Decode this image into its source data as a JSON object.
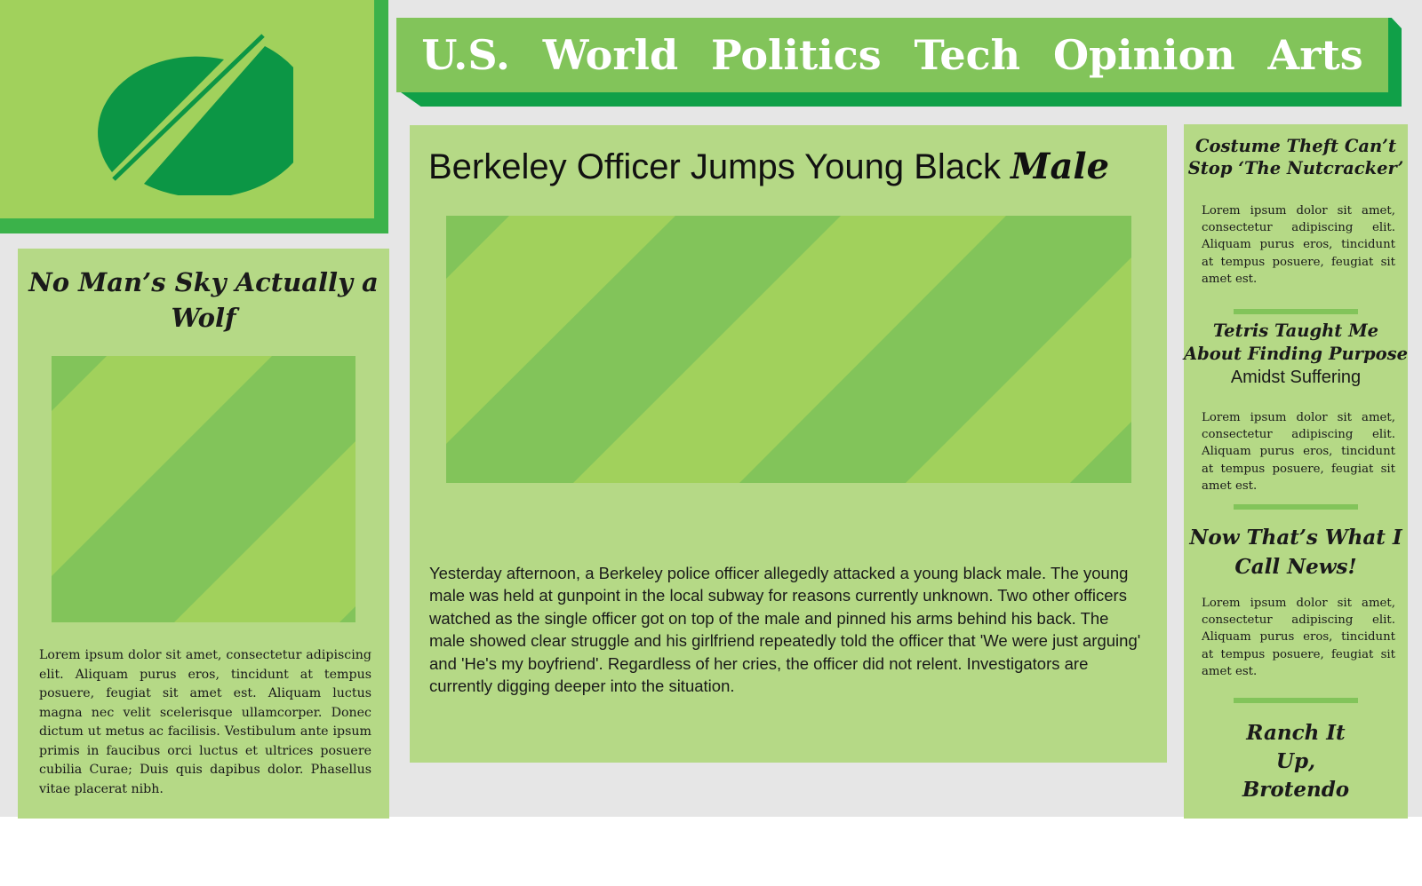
{
  "colors": {
    "page_background": "#e6e6e6",
    "logo_box": "#a1d15c",
    "logo_shadow": "#3bb24a",
    "logo_mark": "#0c9645",
    "nav_bar": "#82c45a",
    "nav_shadow": "#10a048",
    "card": "#b5d986",
    "divider": "#82c45a",
    "image_stripe_dark": "#82c45a",
    "image_stripe_light": "#a1d15c",
    "text": "#1a1a1a",
    "nav_text": "#ffffff"
  },
  "logo": {
    "icon": "split-circle-logo-icon"
  },
  "nav": {
    "items": [
      {
        "label": "U.S."
      },
      {
        "label": "World"
      },
      {
        "label": "Politics"
      },
      {
        "label": "Tech"
      },
      {
        "label": "Opinion"
      },
      {
        "label": "Arts"
      }
    ]
  },
  "left_article": {
    "title": "No Man’s Sky Actually a Wolf",
    "image": "placeholder-image",
    "body": "Lorem ipsum dolor sit amet, consectetur adipiscing elit. Aliquam purus eros, tincidunt at tempus posuere, feugiat sit amet est. Aliquam luctus magna nec velit scelerisque ullamcorper. Donec dictum ut metus ac facilisis. Vestibulum ante ipsum primis in faucibus orci luctus et ultrices posuere cubilia Curae; Duis quis dapibus dolor. Phasellus vitae placerat nibh."
  },
  "main_article": {
    "title": "Berkeley Officer Jumps Young Black",
    "title_emphasis": "Male",
    "image": "placeholder-image",
    "body": "Yesterday afternoon, a Berkeley police officer allegedly attacked a young black male. The young male was held at gunpoint in the local subway for reasons currently unknown. Two other officers watched as the single officer got on top of the male and pinned his arms behind his back. The male showed clear struggle and his girlfriend repeatedly told the officer that 'We were just arguing' and 'He's my boyfriend'. Regardless of her cries, the officer did not relent. Investigators are currently digging deeper into the situation."
  },
  "sidebar": {
    "stories": [
      {
        "title": "Costume Theft Can’t Stop ‘The Nutcracker’",
        "body": "Lorem ipsum dolor sit amet, consectetur adipiscing elit. Aliquam purus eros, tincidunt at tempus posuere, feugiat sit amet est."
      },
      {
        "title": "Tetris Taught Me About Finding Purpose",
        "subtitle": "Amidst Suffering",
        "body": "Lorem ipsum dolor sit amet, consectetur adipiscing elit. Aliquam purus eros, tincidunt at tempus posuere, feugiat sit amet est."
      },
      {
        "title": "Now That’s What I Call News!",
        "body": "Lorem ipsum dolor sit amet, consectetur adipiscing elit. Aliquam purus eros, tincidunt at tempus posuere, feugiat sit amet est."
      },
      {
        "title": "Ranch It Up, Brotendo"
      }
    ]
  }
}
